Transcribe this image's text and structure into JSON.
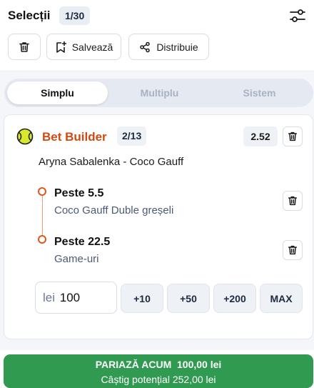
{
  "header": {
    "title": "Selecții",
    "count": "1/30",
    "buttons": {
      "save_label": "Salvează",
      "share_label": "Distribuie"
    }
  },
  "tabs": [
    {
      "label": "Simplu",
      "active": true
    },
    {
      "label": "Multiplu",
      "active": false
    },
    {
      "label": "Sistem",
      "active": false
    }
  ],
  "bet_builder": {
    "title": "Bet Builder",
    "count": "2/13",
    "odds": "2.52",
    "match": "Aryna Sabalenka - Coco Gauff",
    "selections": [
      {
        "title": "Peste 5.5",
        "subtitle": "Coco Gauff Duble greșeli"
      },
      {
        "title": "Peste 22.5",
        "subtitle": "Game-uri"
      }
    ]
  },
  "stake": {
    "currency": "lei",
    "value": "100",
    "quick_buttons": [
      "+10",
      "+50",
      "+200",
      "MAX"
    ]
  },
  "cta": {
    "label": "PARIAZĂ ACUM",
    "amount": "100,00 lei",
    "potential": "Câștig potențial 252,00 lei"
  },
  "colors": {
    "accent": "#d14a10",
    "cta_green": "#2f9a50",
    "badge_bg": "#e9edf4"
  },
  "icons": [
    "filter-sliders-icon",
    "trash-icon",
    "bookmark-add-icon",
    "share-icon",
    "tennis-ball-icon"
  ]
}
